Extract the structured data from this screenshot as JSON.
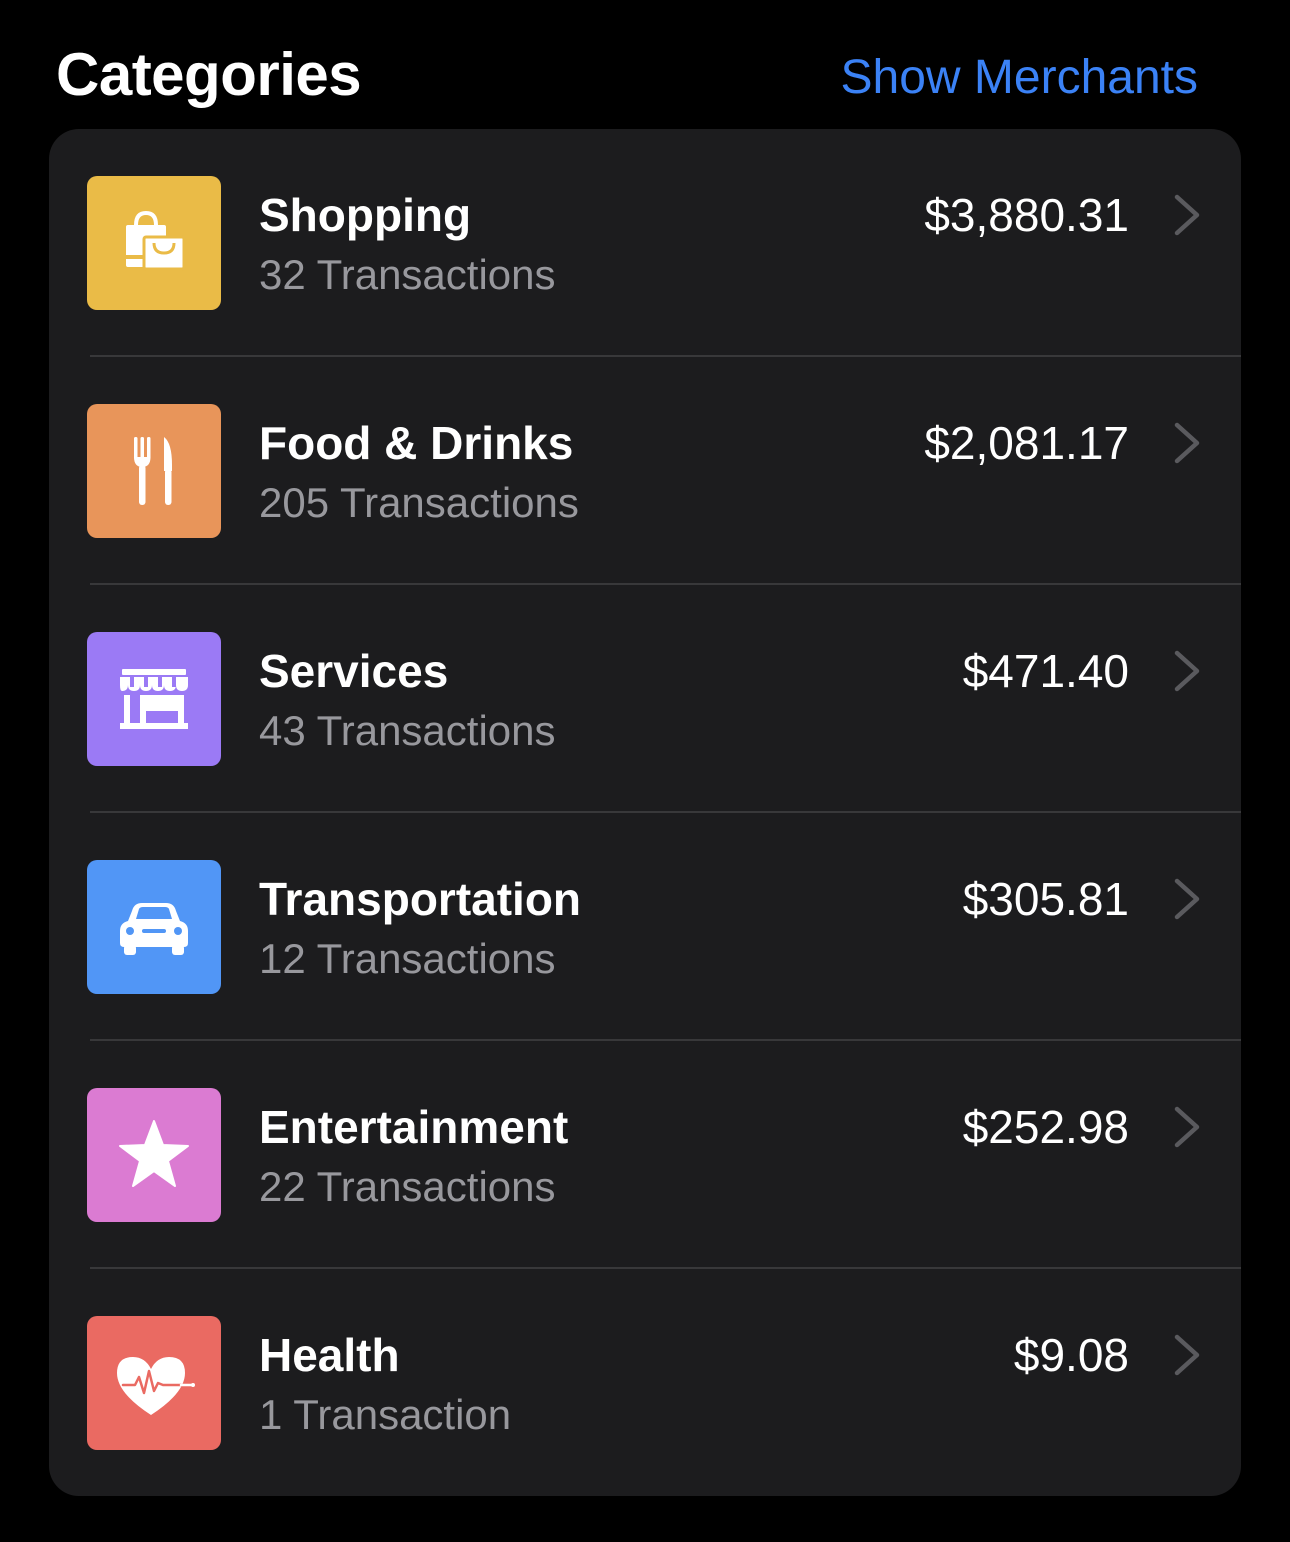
{
  "header": {
    "title": "Categories",
    "show_merchants_label": "Show Merchants"
  },
  "categories": [
    {
      "name": "Shopping",
      "transactions": "32 Transactions",
      "amount": "$3,880.31",
      "icon": "shopping-bags-icon",
      "color": "#eabb47"
    },
    {
      "name": "Food & Drinks",
      "transactions": "205 Transactions",
      "amount": "$2,081.17",
      "icon": "fork-knife-icon",
      "color": "#e8955a"
    },
    {
      "name": "Services",
      "transactions": "43 Transactions",
      "amount": "$471.40",
      "icon": "storefront-icon",
      "color": "#9b7af5"
    },
    {
      "name": "Transportation",
      "transactions": "12 Transactions",
      "amount": "$305.81",
      "icon": "car-icon",
      "color": "#5196f6"
    },
    {
      "name": "Entertainment",
      "transactions": "22 Transactions",
      "amount": "$252.98",
      "icon": "star-icon",
      "color": "#db7bd2"
    },
    {
      "name": "Health",
      "transactions": "1 Transaction",
      "amount": "$9.08",
      "icon": "heart-pulse-icon",
      "color": "#ea6a62"
    }
  ],
  "colors": {
    "background": "#000000",
    "card": "#1c1c1e",
    "accent": "#3b82f6",
    "secondary_text": "#98989d",
    "chevron": "#5a5a5e"
  }
}
